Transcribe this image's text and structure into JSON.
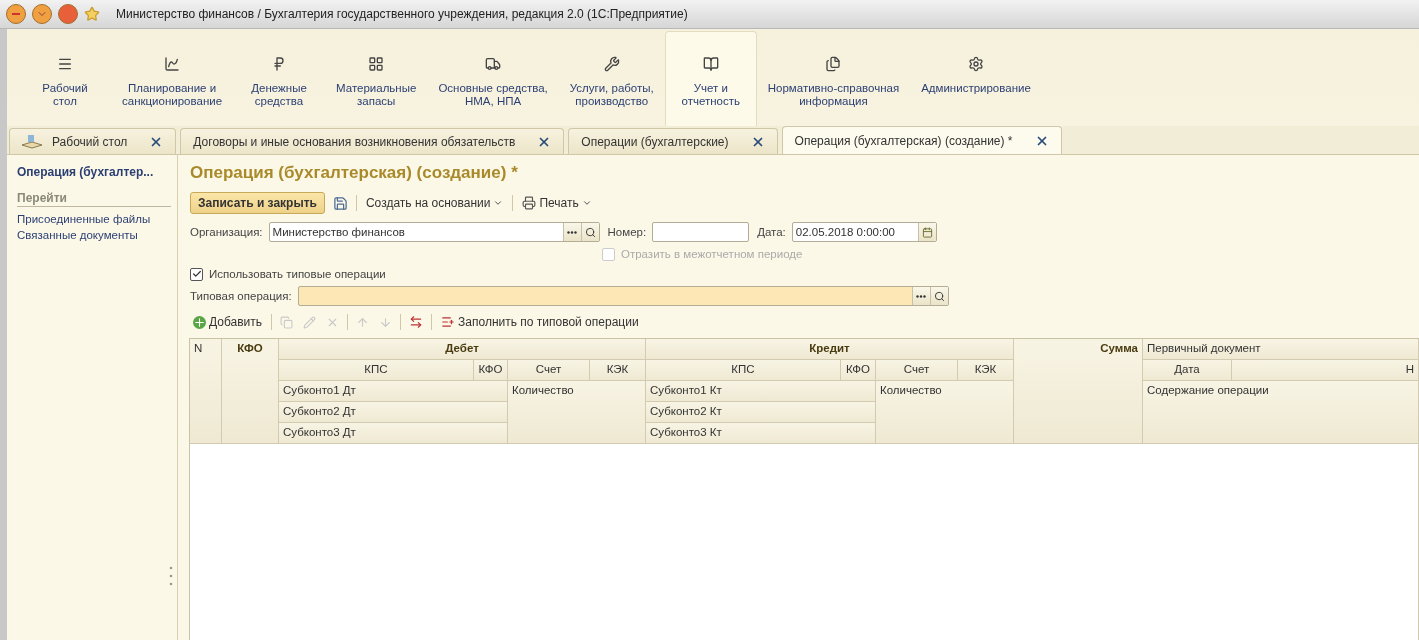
{
  "window": {
    "title": "Министерство финансов / Бухгалтерия государственного учреждения, редакция 2.0  (1С:Предприятие)"
  },
  "sections": [
    {
      "label": [
        "Рабочий",
        "стол"
      ],
      "kind": "desktop",
      "selected": false
    },
    {
      "label": [
        "Планирование и",
        "санкционирование"
      ],
      "kind": "planning",
      "selected": false
    },
    {
      "label": [
        "Денежные",
        "средства"
      ],
      "kind": "money",
      "selected": false
    },
    {
      "label": [
        "Материальные",
        "запасы"
      ],
      "kind": "stock",
      "selected": false
    },
    {
      "label": [
        "Основные средства,",
        "НМА, НПА"
      ],
      "kind": "assets",
      "selected": false
    },
    {
      "label": [
        "Услуги, работы,",
        "производство"
      ],
      "kind": "services",
      "selected": false
    },
    {
      "label": [
        "Учет и",
        "отчетность"
      ],
      "kind": "ledger",
      "selected": true
    },
    {
      "label": [
        "Нормативно-справочная",
        "информация"
      ],
      "kind": "reference",
      "selected": false
    },
    {
      "label": [
        "Администрирование"
      ],
      "kind": "admin",
      "selected": false
    }
  ],
  "tabs": [
    {
      "label": "Рабочий стол",
      "kind": "home",
      "selected": false
    },
    {
      "label": "Договоры и иные основания возникновения обязательств",
      "kind": "plain",
      "selected": false
    },
    {
      "label": "Операции (бухгалтерские)",
      "kind": "plain",
      "selected": false
    },
    {
      "label": "Операция (бухгалтерская) (создание) *",
      "kind": "plain",
      "selected": true
    }
  ],
  "sidebar": {
    "title": "Операция (бухгалтер...",
    "group": "Перейти",
    "items": [
      "Присоединенные файлы",
      "Связанные документы"
    ]
  },
  "form": {
    "title": "Операция (бухгалтерская) (создание) *",
    "toolbar": {
      "primary": "Записать и закрыть",
      "create_based": "Создать на основании",
      "print": "Печать"
    },
    "organization": {
      "label": "Организация:",
      "value": "Министерство финансов"
    },
    "number": {
      "label": "Номер:"
    },
    "date": {
      "label": "Дата:",
      "value": "02.05.2018  0:00:00"
    },
    "interperiod": {
      "label": "Отразить в межотчетном периоде",
      "checked": false,
      "disabled": true
    },
    "use_typical": {
      "label": "Использовать типовые операции",
      "checked": true,
      "disabled": false
    },
    "typical_operation": {
      "label": "Типовая операция:"
    },
    "table_toolbar": {
      "add": "Добавить",
      "fill": "Заполнить по типовой операции"
    }
  },
  "table": {
    "header_cells": [
      {
        "text": "N",
        "kind": "plain"
      },
      {
        "text": "КФО",
        "kind": "bold"
      },
      {
        "text": "Дебет",
        "kind": "bold"
      },
      {
        "text": "КПС",
        "kind": "centered"
      },
      {
        "text": "КФО",
        "kind": "centered"
      },
      {
        "text": "Счет",
        "kind": "centered"
      },
      {
        "text": "КЭК",
        "kind": "centered"
      },
      {
        "text": "Субконто1 Дт",
        "kind": "plain"
      },
      {
        "text": "Субконто2 Дт",
        "kind": "plain"
      },
      {
        "text": "Субконто3 Дт",
        "kind": "plain"
      },
      {
        "text": "Количество",
        "kind": "plain"
      },
      {
        "text": "Кредит",
        "kind": "bold"
      },
      {
        "text": "КПС",
        "kind": "centered"
      },
      {
        "text": "КФО",
        "kind": "centered"
      },
      {
        "text": "Счет",
        "kind": "centered"
      },
      {
        "text": "КЭК",
        "kind": "centered"
      },
      {
        "text": "Субконто1 Кт",
        "kind": "plain"
      },
      {
        "text": "Субконто2 Кт",
        "kind": "plain"
      },
      {
        "text": "Субконто3 Кт",
        "kind": "plain"
      },
      {
        "text": "Количество",
        "kind": "plain"
      },
      {
        "text": "Сумма",
        "kind": "boldright"
      },
      {
        "text": "Первичный документ",
        "kind": "plain"
      },
      {
        "text": "Дата",
        "kind": "centered"
      },
      {
        "text": "Н",
        "kind": "right"
      },
      {
        "text": "Содержание операции",
        "kind": "plain"
      }
    ]
  }
}
